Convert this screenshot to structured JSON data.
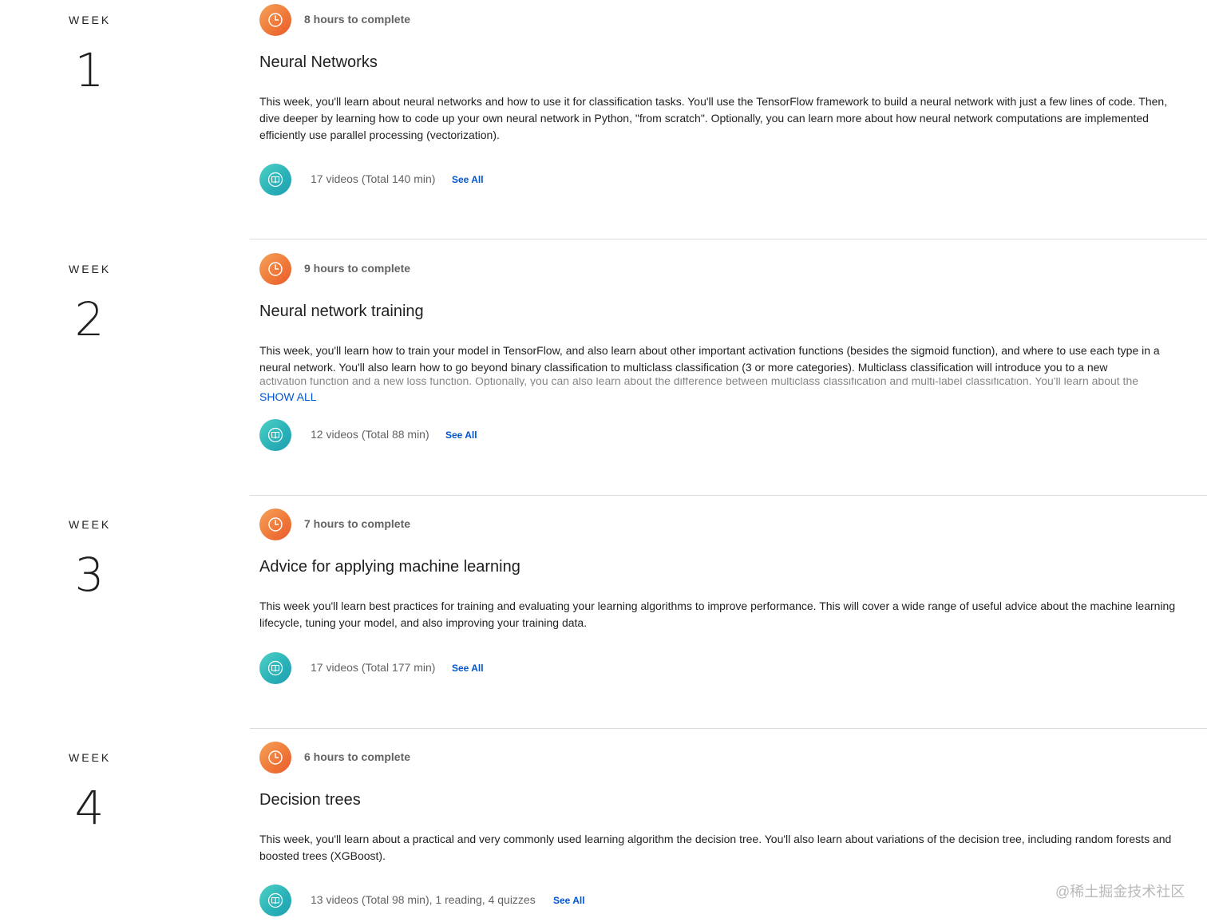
{
  "weeks": [
    {
      "label": "WEEK",
      "number": "1",
      "hours": "8 hours to complete",
      "title": "Neural Networks",
      "description": "This week, you'll learn about neural networks and how to use it for classification tasks. You'll use the TensorFlow framework to build a neural network with just a few lines of code. Then, dive deeper by learning how to code up your own neural network in Python, \"from scratch\". Optionally, you can learn more about how neural network computations are implemented efficiently use parallel processing (vectorization).",
      "videos": "17 videos (Total 140 min)",
      "see_all": "See All"
    },
    {
      "label": "WEEK",
      "number": "2",
      "hours": "9 hours to complete",
      "title": "Neural network training",
      "description": "This week, you'll learn how to train your model in TensorFlow, and also learn about other important activation functions (besides the sigmoid function), and where to use each type in a neural network. You'll also learn how to go beyond binary classification to multiclass classification (3 or more categories). Multiclass classification will introduce you to a new",
      "description_fade": "activation function and a new loss function. Optionally, you can also learn about the difference between multiclass classification and multi-label classification. You'll learn about the",
      "show_all": "SHOW ALL",
      "videos": "12 videos (Total 88 min)",
      "see_all": "See All"
    },
    {
      "label": "WEEK",
      "number": "3",
      "hours": "7 hours to complete",
      "title": "Advice for applying machine learning",
      "description": "This week you'll learn best practices for training and evaluating your learning algorithms to improve performance. This will cover a wide range of useful advice about the machine learning lifecycle, tuning your model, and also improving your training data.",
      "videos": "17 videos (Total 177 min)",
      "see_all": "See All"
    },
    {
      "label": "WEEK",
      "number": "4",
      "hours": "6 hours to complete",
      "title": "Decision trees",
      "description": "This week, you'll learn about a practical and very commonly used learning algorithm the decision tree. You'll also learn about variations of the decision tree, including random forests and boosted trees (XGBoost).",
      "videos": "13 videos (Total 98 min), 1 reading, 4 quizzes",
      "see_all": "See All"
    }
  ],
  "watermark": "@稀土掘金技术社区",
  "icons": {
    "hours": "clock-icon",
    "videos": "book-icon"
  },
  "colors": {
    "accent": "#0056d2",
    "clock_badge": "#f07a3a",
    "book_badge": "#2bb3b8",
    "divider": "#dcdcdc"
  }
}
